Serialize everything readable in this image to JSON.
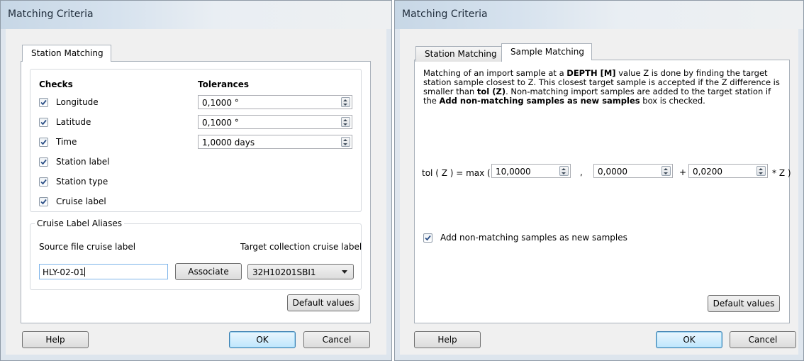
{
  "left": {
    "window_title": "Matching Criteria",
    "tab_station": "Station Matching",
    "checks_header": "Checks",
    "tolerances_header": "Tolerances",
    "checks": [
      {
        "label": "Longitude",
        "checked": true
      },
      {
        "label": "Latitude",
        "checked": true
      },
      {
        "label": "Time",
        "checked": true
      },
      {
        "label": "Station label",
        "checked": true
      },
      {
        "label": "Station type",
        "checked": true
      },
      {
        "label": "Cruise label",
        "checked": true
      }
    ],
    "tolerances": [
      "0,1000 °",
      "0,1000 °",
      "1,0000 days"
    ],
    "aliases_group": "Cruise Label Aliases",
    "source_label": "Source file cruise label",
    "target_label": "Target collection cruise label",
    "source_value": "HLY-02-01",
    "associate_button": "Associate",
    "target_value": "32H10201SBI1",
    "default_values": "Default values",
    "help": "Help",
    "ok": "OK",
    "cancel": "Cancel"
  },
  "right": {
    "window_title": "Matching Criteria",
    "tab_station": "Station Matching",
    "tab_sample": "Sample Matching",
    "desc": {
      "p1": "Matching of an import sample at a ",
      "b1": "DEPTH [M]",
      "p2": " value Z is done by finding the target station sample closest to Z. This closest target sample is accepted if the Z difference is smaller than ",
      "b2": "tol (Z)",
      "p3": ". Non-matching import samples are added to the target station if the ",
      "b3": "Add non-matching samples as new samples",
      "p4": " box is checked."
    },
    "formula_prefix": "tol ( Z ) = max (",
    "value1": "10,0000",
    "comma": ",",
    "value2": "0,0000",
    "plus": "+",
    "value3": "0,0200",
    "suffix": "* Z )",
    "add_nonmatching_label": "Add non-matching samples as new samples",
    "add_nonmatching_checked": true,
    "default_values": "Default values",
    "help": "Help",
    "ok": "OK",
    "cancel": "Cancel"
  }
}
